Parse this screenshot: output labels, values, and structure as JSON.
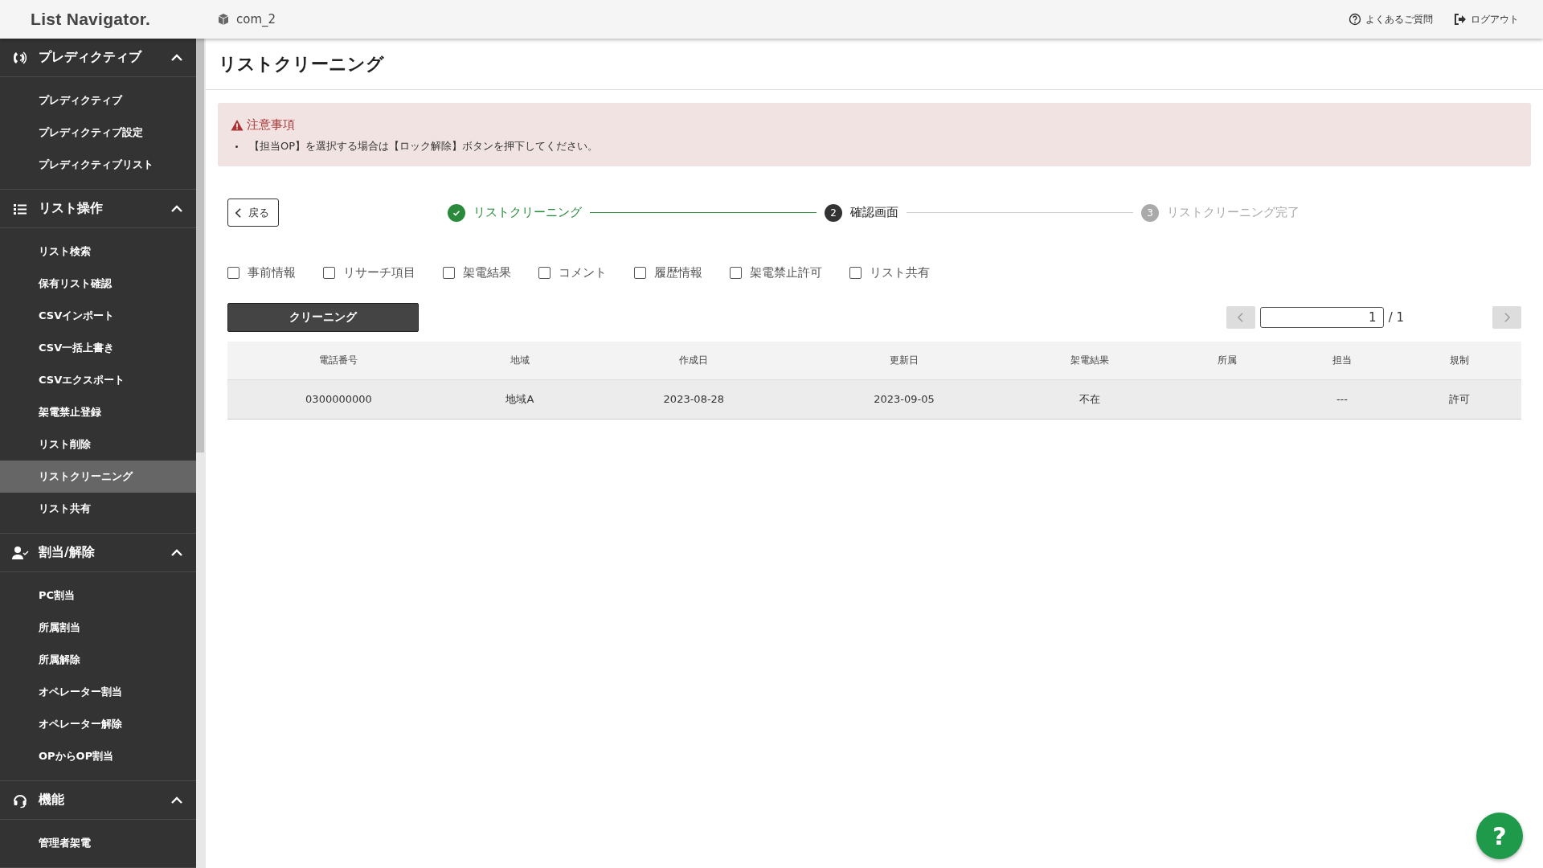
{
  "header": {
    "logo": "List Navigator.",
    "company": "com_2",
    "links": [
      {
        "kind": "faq",
        "label": "よくあるご質問"
      },
      {
        "kind": "logout",
        "label": "ログアウト"
      }
    ]
  },
  "sidebar": {
    "groups": [
      {
        "kind": "phone",
        "title": "プレディクティブ",
        "expanded": true,
        "items": [
          {
            "label": "プレディクティブ",
            "selected": false
          },
          {
            "label": "プレディクティブ設定",
            "selected": false
          },
          {
            "label": "プレディクティブリスト",
            "selected": false
          }
        ]
      },
      {
        "kind": "list",
        "title": "リスト操作",
        "expanded": true,
        "items": [
          {
            "label": "リスト検索",
            "selected": false
          },
          {
            "label": "保有リスト確認",
            "selected": false
          },
          {
            "label": "CSVインポート",
            "selected": false
          },
          {
            "label": "CSV一括上書き",
            "selected": false
          },
          {
            "label": "CSVエクスポート",
            "selected": false
          },
          {
            "label": "架電禁止登録",
            "selected": false
          },
          {
            "label": "リスト削除",
            "selected": false
          },
          {
            "label": "リストクリーニング",
            "selected": true
          },
          {
            "label": "リスト共有",
            "selected": false
          }
        ]
      },
      {
        "kind": "user",
        "title": "割当/解除",
        "expanded": true,
        "items": [
          {
            "label": "PC割当",
            "selected": false
          },
          {
            "label": "所属割当",
            "selected": false
          },
          {
            "label": "所属解除",
            "selected": false
          },
          {
            "label": "オペレーター割当",
            "selected": false
          },
          {
            "label": "オペレーター解除",
            "selected": false
          },
          {
            "label": "OPからOP割当",
            "selected": false
          }
        ]
      },
      {
        "kind": "headset",
        "title": "機能",
        "expanded": true,
        "items": [
          {
            "label": "管理者架電",
            "selected": false
          }
        ]
      }
    ]
  },
  "page_title": "リストクリーニング",
  "notice": {
    "title": "注意事項",
    "items": [
      "【担当OP】を選択する場合は【ロック解除】ボタンを押下してください。"
    ]
  },
  "back_button": "戻る",
  "steps": [
    {
      "label": "リストクリーニング",
      "kind": "done"
    },
    {
      "number": "2",
      "label": "確認画面",
      "kind": "current"
    },
    {
      "number": "3",
      "label": "リストクリーニング完了",
      "kind": "pending"
    }
  ],
  "options": [
    {
      "label": "事前情報",
      "checked": false
    },
    {
      "label": "リサーチ項目",
      "checked": false
    },
    {
      "label": "架電結果",
      "checked": false
    },
    {
      "label": "コメント",
      "checked": false
    },
    {
      "label": "履歴情報",
      "checked": false
    },
    {
      "label": "架電禁止許可",
      "checked": false
    },
    {
      "label": "リスト共有",
      "checked": false
    }
  ],
  "cleaning_button": "クリーニング",
  "pagination": {
    "page": "1",
    "total": "/ 1"
  },
  "table": {
    "columns": [
      "電話番号",
      "地域",
      "作成日",
      "更新日",
      "架電結果",
      "所属",
      "担当",
      "規制"
    ],
    "rows": [
      [
        "0300000000",
        "地域A",
        "2023-08-28",
        "2023-09-05",
        "不在",
        "",
        "---",
        "許可"
      ]
    ]
  },
  "help_button": "?"
}
